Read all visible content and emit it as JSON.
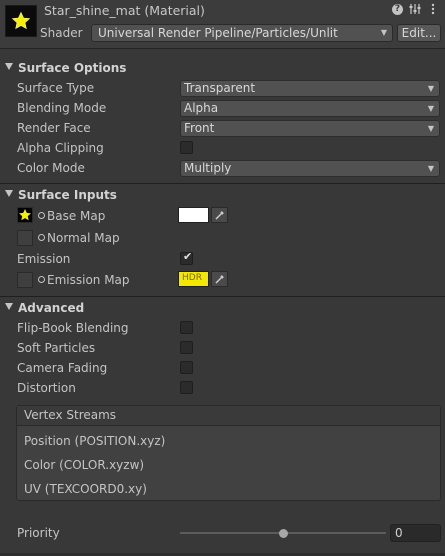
{
  "header": {
    "title": "Star_shine_mat (Material)",
    "shader_label": "Shader",
    "shader_value": "Universal Render Pipeline/Particles/Unlit",
    "edit_label": "Edit...",
    "icons": [
      "help-icon",
      "settings-sliders-icon",
      "more-menu-icon"
    ]
  },
  "surface_options": {
    "title": "Surface Options",
    "surface_type_label": "Surface Type",
    "surface_type_value": "Transparent",
    "blending_mode_label": "Blending Mode",
    "blending_mode_value": "Alpha",
    "render_face_label": "Render Face",
    "render_face_value": "Front",
    "alpha_clipping_label": "Alpha Clipping",
    "alpha_clipping_checked": false,
    "color_mode_label": "Color Mode",
    "color_mode_value": "Multiply"
  },
  "surface_inputs": {
    "title": "Surface Inputs",
    "base_map_label": "Base Map",
    "base_map_color": "#ffffff",
    "normal_map_label": "Normal Map",
    "emission_label": "Emission",
    "emission_checked": true,
    "emission_map_label": "Emission Map",
    "emission_color": "#f2e800",
    "emission_hdr_tag": "HDR"
  },
  "advanced": {
    "title": "Advanced",
    "flipbook_label": "Flip-Book Blending",
    "soft_particles_label": "Soft Particles",
    "camera_fading_label": "Camera Fading",
    "distortion_label": "Distortion"
  },
  "vertex_streams": {
    "title": "Vertex Streams",
    "items": [
      "Position (POSITION.xyz)",
      "Color (COLOR.xyzw)",
      "UV (TEXCOORD0.xy)"
    ]
  },
  "priority": {
    "label": "Priority",
    "value": "0",
    "slider_fraction": 0.5
  }
}
